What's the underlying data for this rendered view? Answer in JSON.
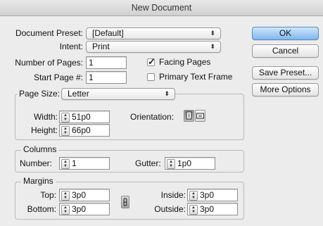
{
  "window": {
    "title": "New Document"
  },
  "preset": {
    "label": "Document Preset:",
    "value": "[Default]"
  },
  "intent": {
    "label": "Intent:",
    "value": "Print"
  },
  "pages": {
    "number_label": "Number of Pages:",
    "number_value": "1",
    "start_label": "Start Page #:",
    "start_value": "1",
    "facing_label": "Facing Pages",
    "facing_checked": true,
    "primary_label": "Primary Text Frame",
    "primary_checked": false
  },
  "page_size": {
    "label": "Page Size:",
    "value": "Letter",
    "width_label": "Width:",
    "width_value": "51p0",
    "height_label": "Height:",
    "height_value": "66p0",
    "orientation_label": "Orientation:"
  },
  "columns": {
    "legend": "Columns",
    "number_label": "Number:",
    "number_value": "1",
    "gutter_label": "Gutter:",
    "gutter_value": "1p0"
  },
  "margins": {
    "legend": "Margins",
    "top_label": "Top:",
    "top_value": "3p0",
    "bottom_label": "Bottom:",
    "bottom_value": "3p0",
    "inside_label": "Inside:",
    "inside_value": "3p0",
    "outside_label": "Outside:",
    "outside_value": "3p0"
  },
  "buttons": {
    "ok": "OK",
    "cancel": "Cancel",
    "save_preset": "Save Preset...",
    "more_options": "More Options"
  },
  "icons": {
    "select_arrows": "select-arrows-icon",
    "stepper": "stepper-icon",
    "portrait": "portrait-orientation-icon",
    "landscape": "landscape-orientation-icon",
    "chain": "chain-link-icon"
  },
  "colors": {
    "accent": "#7fb7ee",
    "background": "#ececec"
  }
}
